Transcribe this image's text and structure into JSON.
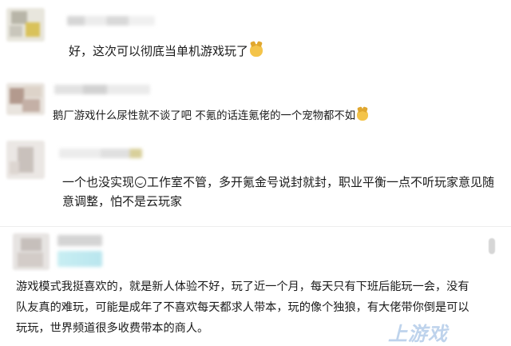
{
  "comments": [
    {
      "text_lines": [
        "好，这次可以彻底当单机游戏玩了"
      ],
      "emoji": "dog-emoji"
    },
    {
      "text_lines": [
        "鹅厂游戏什么尿性就不谈了吧  不氪的话连氪佬的一个宠物都不如"
      ],
      "emoji": "dog-emoji"
    },
    {
      "text_part1": "一个也没实现",
      "text_part2": "工作室不管，多开氪金号说封就封，职业平衡一点不听玩家意见随",
      "text_line2": "意调整，怕不是云玩家",
      "emoji": "smile-emoji"
    },
    {
      "text_lines": [
        "游戏模式我挺喜欢的，就是新人体验不好，玩了近一个月，每天只有下班后能玩一会，没有",
        "队友真的难玩，可能是成年了不喜欢每天都求人带本，玩的像个独狼，有大佬带你倒是可以",
        "玩玩，世界频道很多收费带本的商人。"
      ]
    }
  ],
  "watermark": "上游戏"
}
